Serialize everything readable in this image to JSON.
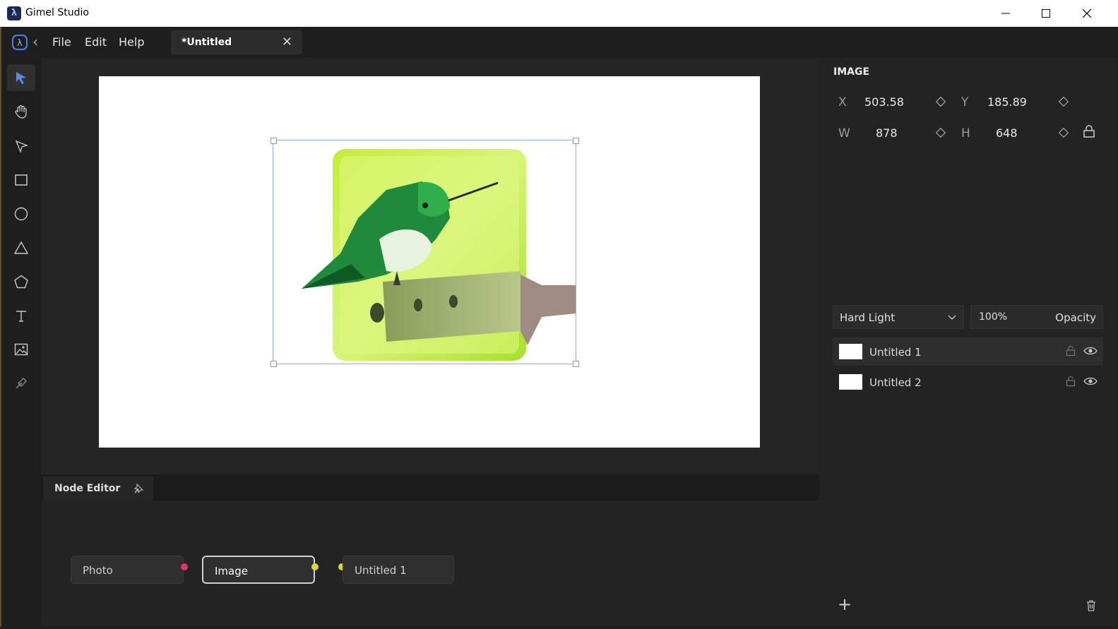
{
  "window": {
    "title": "Gimel Studio",
    "app_icon_glyph": "λ"
  },
  "menubar": {
    "items": [
      "File",
      "Edit",
      "Help"
    ],
    "back_glyph": "‹",
    "doc_tab": {
      "label": "*Untitled",
      "close_glyph": "✕"
    }
  },
  "toolbar": {
    "tools": [
      "select-tool",
      "hand-tool",
      "node-select-tool",
      "rectangle-tool",
      "ellipse-tool",
      "triangle-tool",
      "polygon-tool",
      "text-tool",
      "image-tool",
      "eyedropper-tool"
    ],
    "active_tool": "select-tool"
  },
  "properties": {
    "section_title": "IMAGE",
    "x": {
      "label": "X",
      "value": "503.58"
    },
    "y": {
      "label": "Y",
      "value": "185.89"
    },
    "w": {
      "label": "W",
      "value": "878"
    },
    "h": {
      "label": "H",
      "value": "648"
    }
  },
  "layers_panel": {
    "blend_mode": "Hard Light",
    "opacity_value": "100%",
    "opacity_label": "Opacity",
    "layers": [
      {
        "name": "Untitled 1",
        "selected": true
      },
      {
        "name": "Untitled 2",
        "selected": false
      }
    ],
    "add_glyph": "+"
  },
  "node_editor": {
    "title": "Node Editor",
    "nodes": [
      {
        "label": "Photo",
        "socket_color": "#e0336a"
      },
      {
        "label": "Image",
        "socket_color": "#d9d92a"
      },
      {
        "label": "Untitled 1",
        "socket_color": "#d9d92a"
      }
    ]
  },
  "colors": {
    "accent": "#4f7ee8",
    "panel_bg": "#232323",
    "selection": "#8ab0da"
  }
}
